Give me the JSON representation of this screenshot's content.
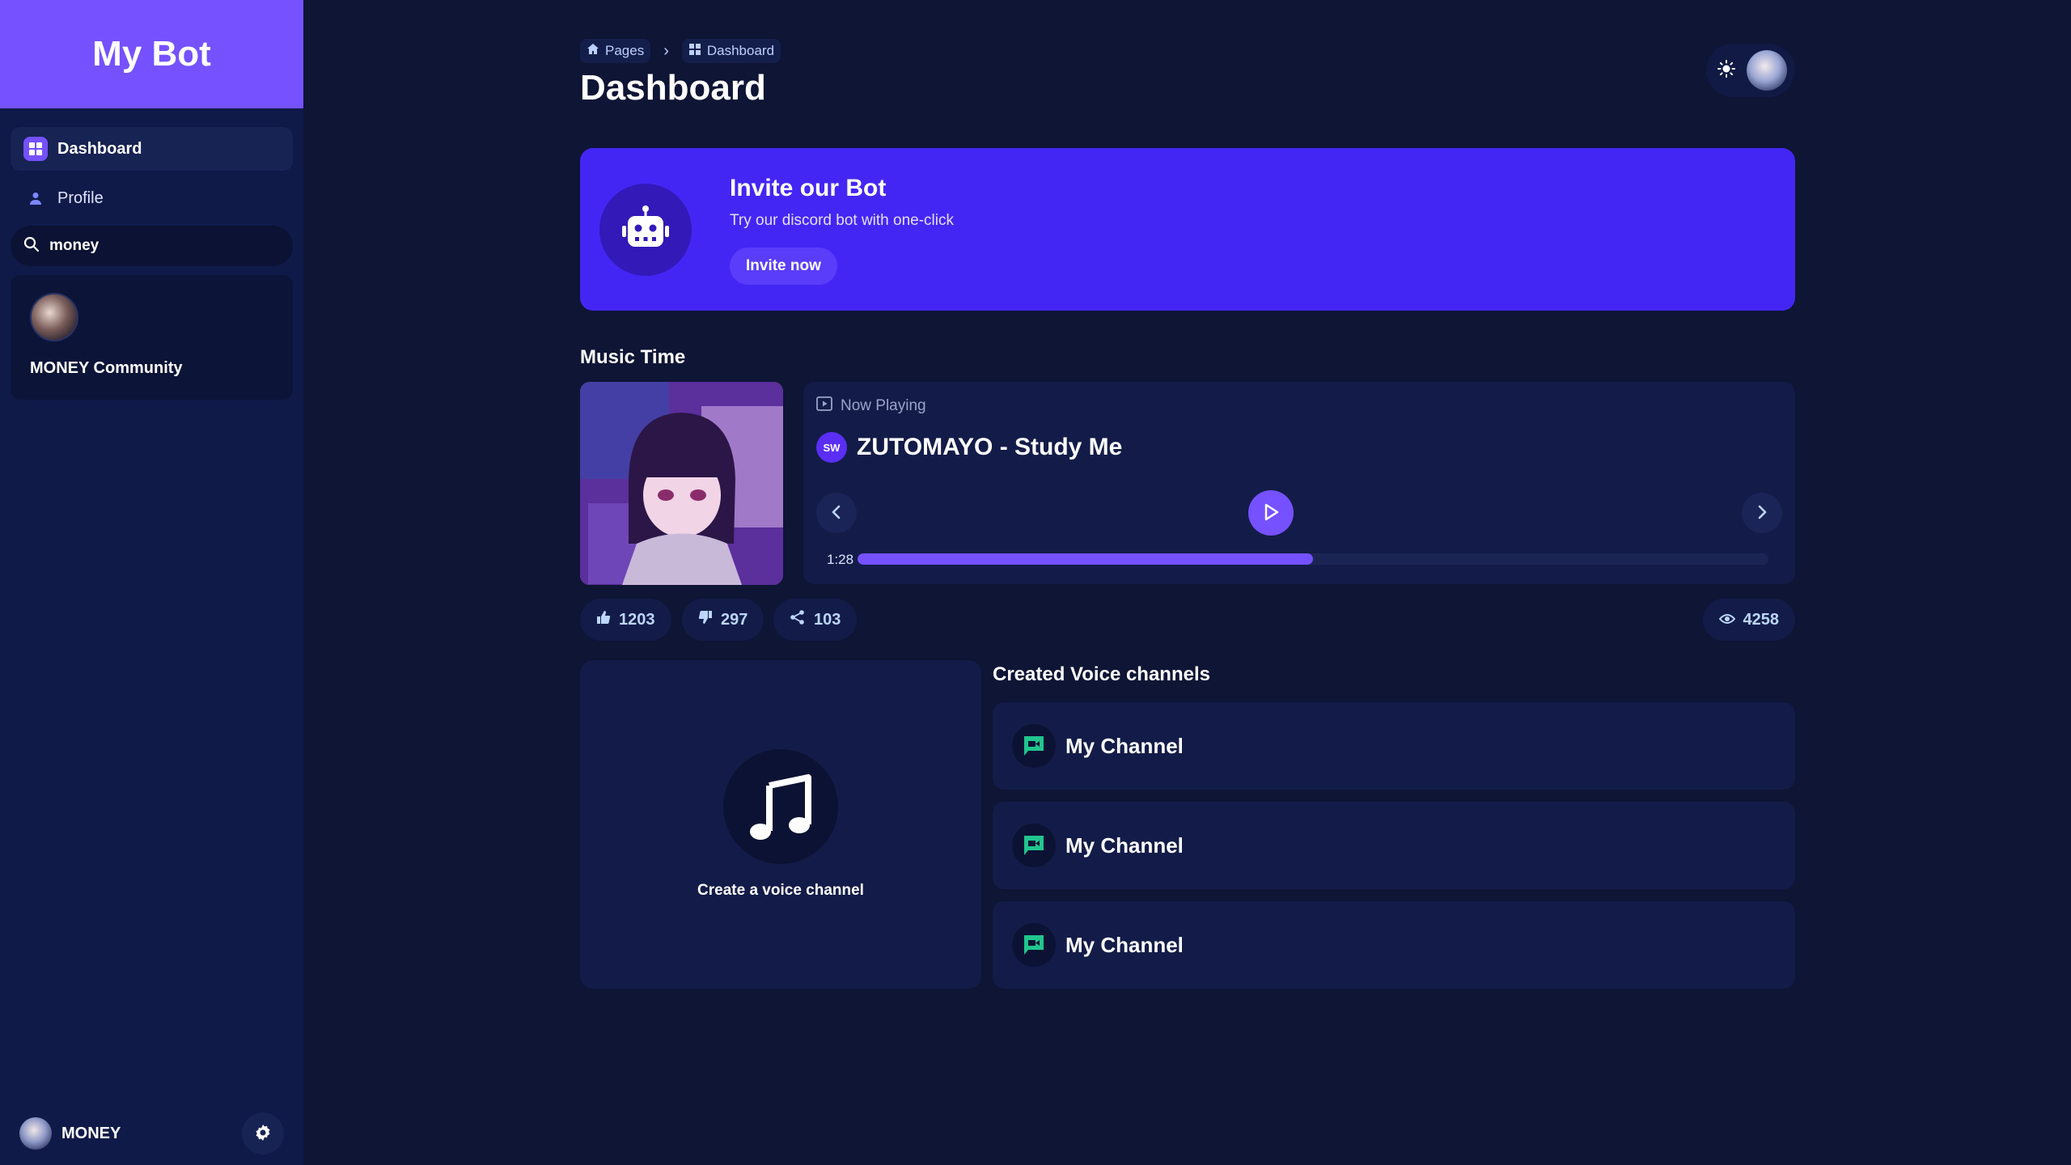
{
  "sidebar": {
    "brand": "My Bot",
    "nav": [
      {
        "label": "Dashboard",
        "icon": "dashboard-icon"
      },
      {
        "label": "Profile",
        "icon": "person-icon"
      }
    ],
    "search": {
      "value": "money",
      "placeholder": ""
    },
    "guild": {
      "name": "MONEY Community"
    },
    "user": {
      "name": "MONEY"
    }
  },
  "header": {
    "breadcrumb": [
      {
        "label": "Pages",
        "icon": "home-icon"
      },
      {
        "label": "Dashboard",
        "icon": "dashboard-icon"
      }
    ],
    "title": "Dashboard"
  },
  "invite": {
    "title": "Invite our Bot",
    "subtitle": "Try our discord bot with one-click",
    "button": "Invite now"
  },
  "music": {
    "section_title": "Music Time",
    "now_playing_label": "Now Playing",
    "artist_badge": "SW",
    "track_title": "ZUTOMAYO - Study Me",
    "time": "1:28",
    "progress_fraction": 0.5,
    "stats": {
      "likes": "1203",
      "dislikes": "297",
      "shares": "103",
      "views": "4258"
    }
  },
  "voice": {
    "create_label": "Create a voice channel",
    "section_title": "Created Voice channels",
    "channels": [
      {
        "name": "My Channel"
      },
      {
        "name": "My Channel"
      },
      {
        "name": "My Channel"
      }
    ]
  },
  "colors": {
    "accent": "#7551ff",
    "banner": "#4426f4",
    "background": "#0e1535",
    "sidebar": "#0f1a48",
    "card": "#131c48",
    "channel_icon": "#21c58e"
  }
}
